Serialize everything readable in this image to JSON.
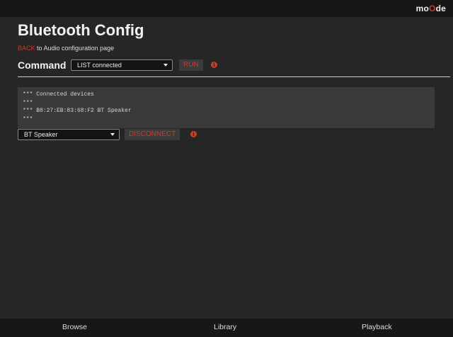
{
  "app": {
    "logo_prefix": "mo",
    "logo_accent": "O",
    "logo_suffix": "de"
  },
  "page": {
    "title": "Bluetooth Config",
    "back_label": "BACK",
    "subtitle_rest": " to Audio configuration page"
  },
  "command": {
    "label": "Command",
    "selected": "LIST connected",
    "run_label": "RUN",
    "info_glyph": "i"
  },
  "output": {
    "text": "*** Connected devices\n***\n*** B8:27:EB:83:68:F2 BT Speaker\n***"
  },
  "device": {
    "selected": "BT Speaker",
    "disconnect_label": "DISCONNECT",
    "info_glyph": "i"
  },
  "nav": {
    "browse": "Browse",
    "library": "Library",
    "playback": "Playback"
  },
  "colors": {
    "accent": "#c93d2c",
    "background": "#262626",
    "bar": "#171717"
  }
}
